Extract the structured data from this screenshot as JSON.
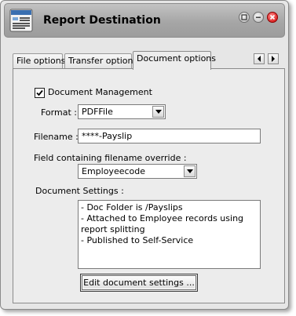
{
  "window": {
    "title": "Report Destination",
    "icon": "report-icon",
    "controls": [
      "restore-icon",
      "minimize-icon",
      "close-icon"
    ],
    "close_color": "#d00000"
  },
  "tabs": [
    {
      "label": "File options",
      "active": false
    },
    {
      "label": "Transfer options",
      "active": false
    },
    {
      "label": "Document options",
      "active": true
    }
  ],
  "tab_scroll": {
    "left_icon": "arrow-left-icon",
    "right_icon": "arrow-right-icon"
  },
  "document_management": {
    "label": "Document Management",
    "checked": true
  },
  "format": {
    "label": "Format :",
    "value": "PDFFile"
  },
  "filename": {
    "label": "Filename :",
    "value": "****-Payslip"
  },
  "override": {
    "label": "Field containing filename override :",
    "value": "Employeecode"
  },
  "document_settings": {
    "label": "Document Settings :",
    "lines": [
      " - Doc Folder is /Payslips",
      " - Attached to Employee records using report splitting",
      " - Published to Self-Service"
    ]
  },
  "edit_button": {
    "label": "Edit document settings ..."
  }
}
